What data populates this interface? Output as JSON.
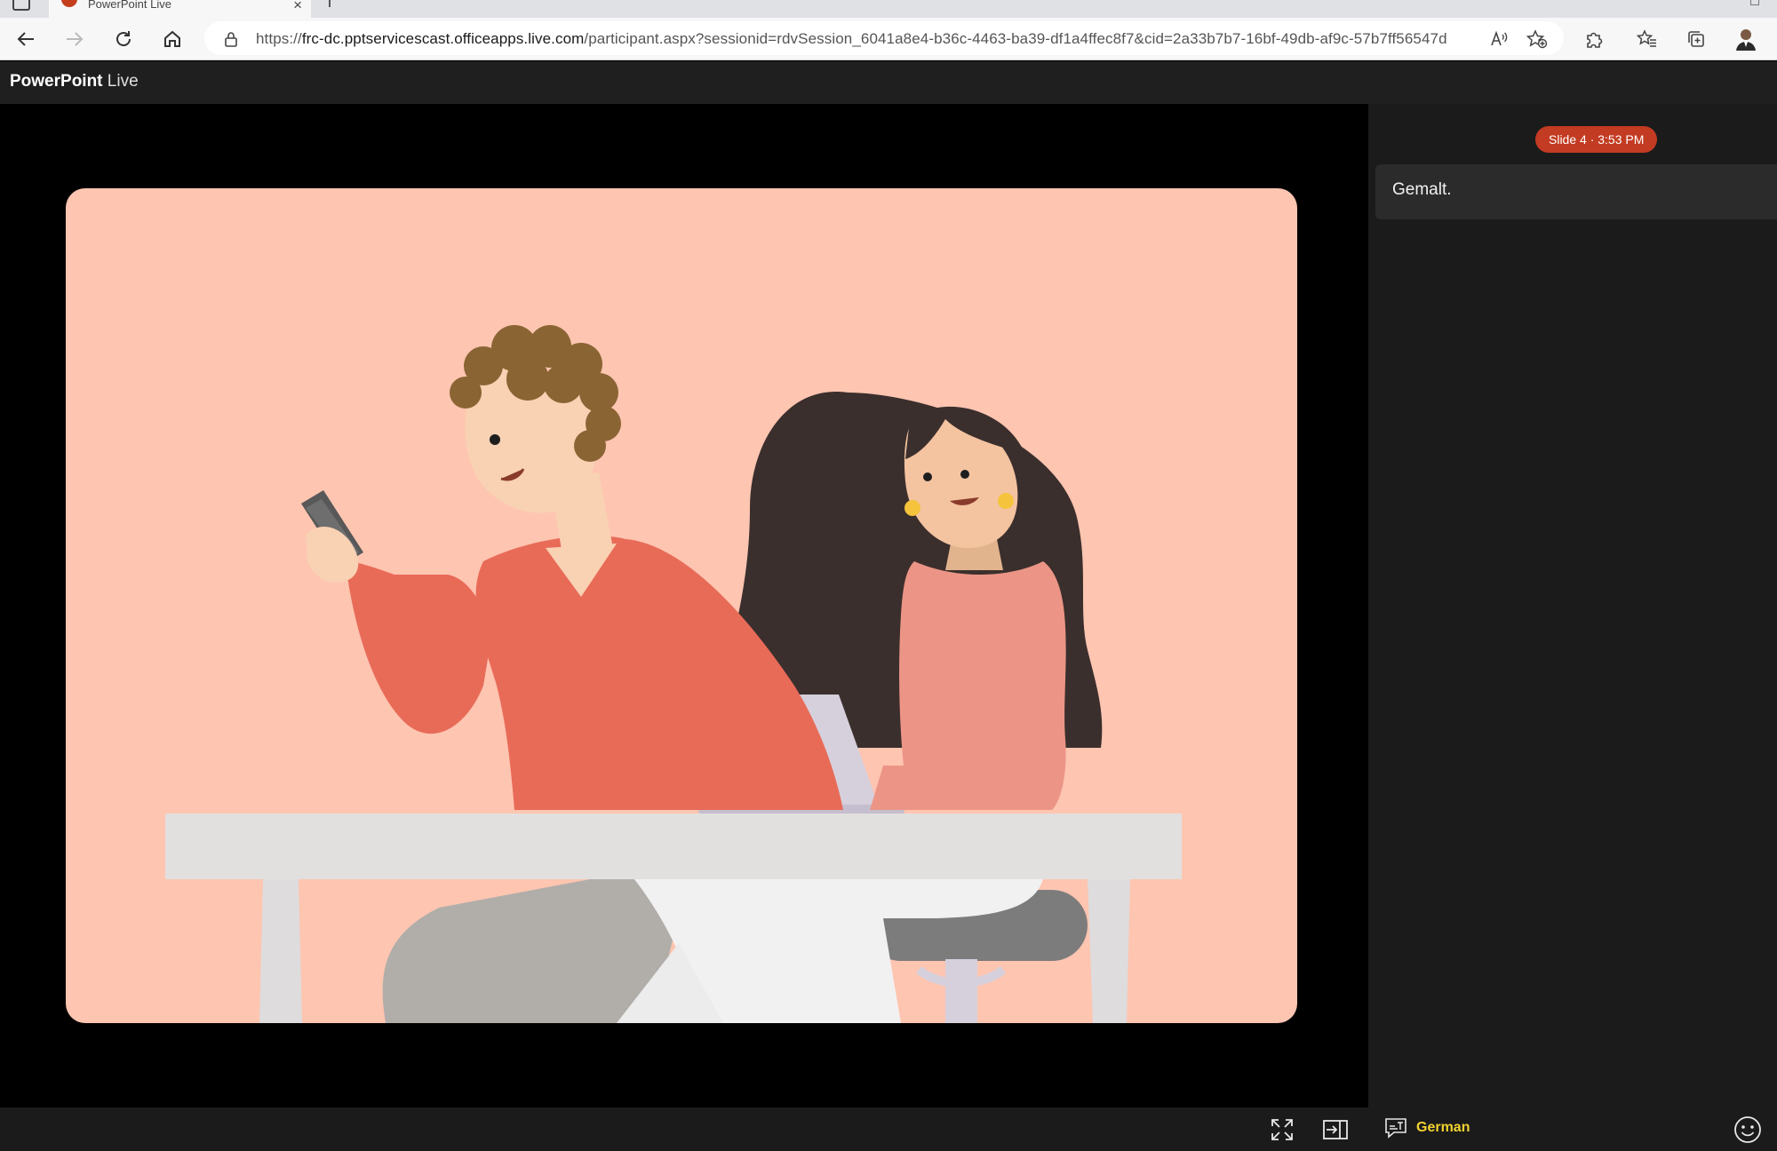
{
  "browser": {
    "tab_title": "PowerPoint Live",
    "url_prefix": "https://",
    "url_host": "frc-dc.pptservicescast.officeapps.live.com",
    "url_path": "/participant.aspx?sessionid=rdvSession_6041a8e4-b36c-4463-ba39-df1a4ffec8f7&cid=2a33b7b7-16bf-49db-af9c-57b7ff56547d"
  },
  "app": {
    "brand_bold": "PowerPoint",
    "brand_light": "Live"
  },
  "panel": {
    "slide_badge": "Slide 4 · 3:53 PM",
    "caption": "Gemalt."
  },
  "footer": {
    "language": "German"
  },
  "colors": {
    "slide_background": "#fec5b1",
    "badge": "#c33b22",
    "language_accent": "#f3d230"
  }
}
